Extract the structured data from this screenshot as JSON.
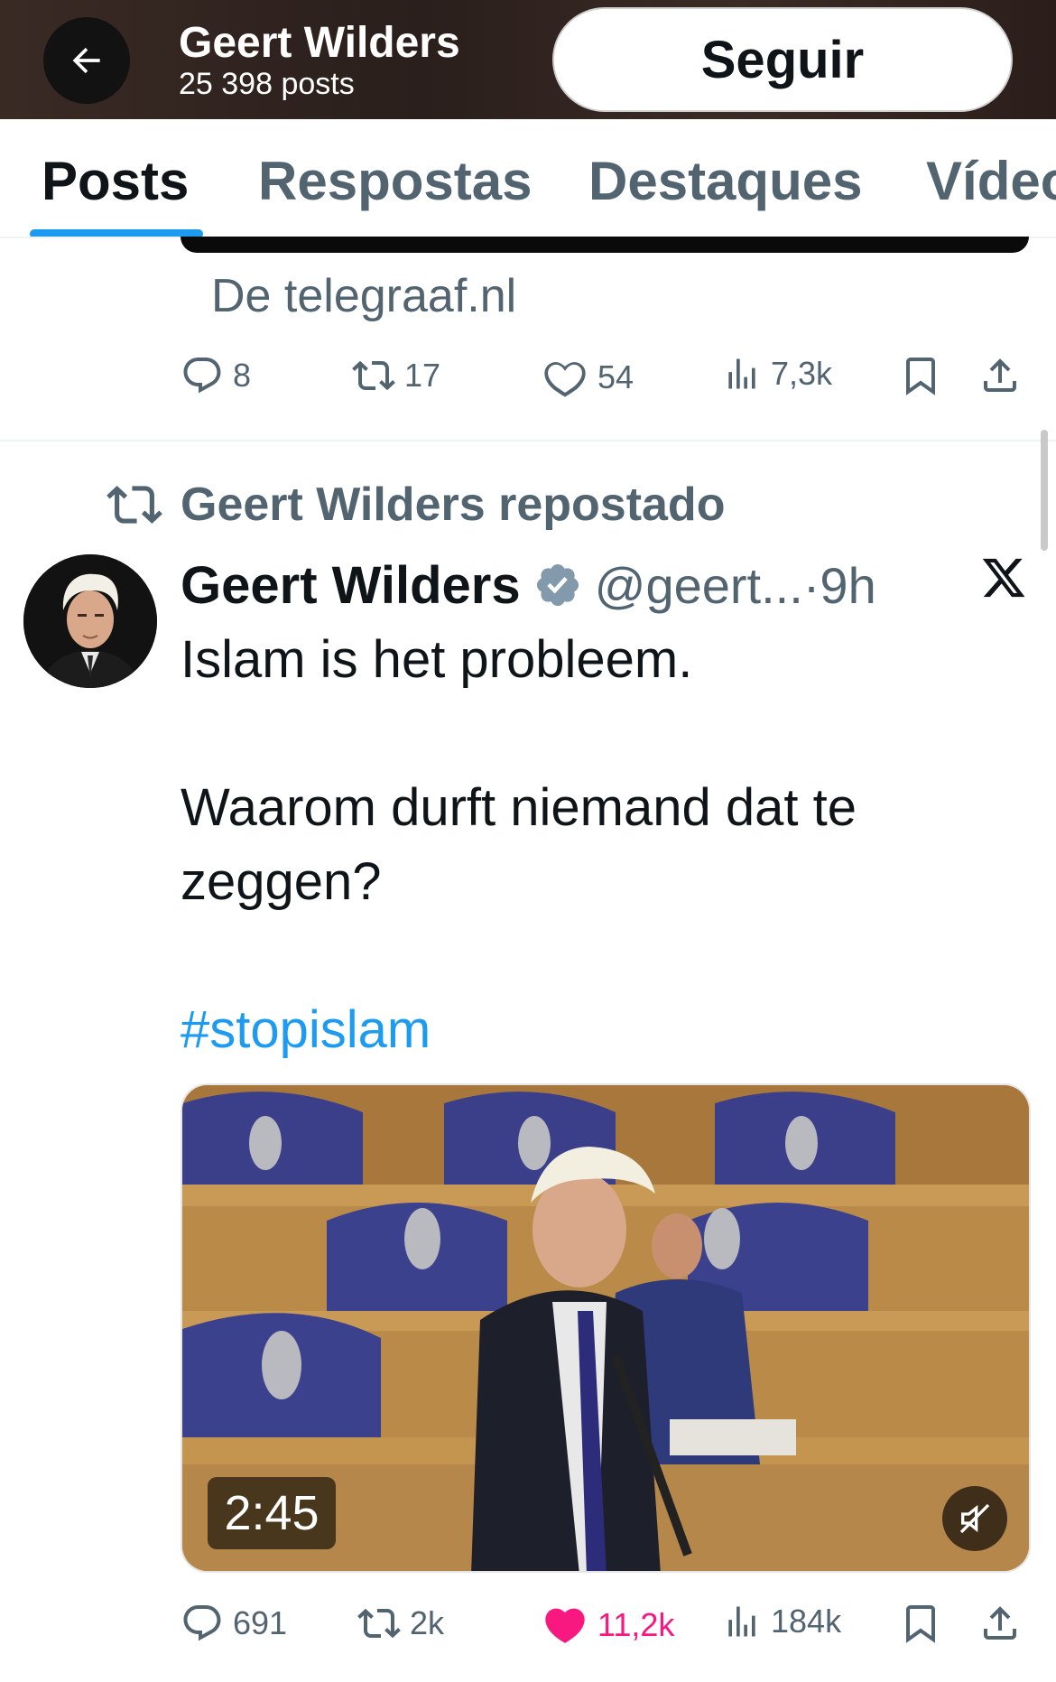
{
  "header": {
    "title": "Geert Wilders",
    "subtitle": "25 398 posts",
    "follow_label": "Seguir"
  },
  "tabs": [
    {
      "label": "Posts",
      "active": true
    },
    {
      "label": "Respostas",
      "active": false
    },
    {
      "label": "Destaques",
      "active": false
    },
    {
      "label": "Vídeos",
      "active": false
    }
  ],
  "previous_post": {
    "link_source": "De telegraaf.nl",
    "stats": {
      "replies": "8",
      "reposts": "17",
      "likes": "54",
      "views": "7,3k"
    }
  },
  "post": {
    "repost_label": "Geert Wilders repostado",
    "author_name": "Geert Wilders",
    "handle": "@geert...",
    "time": "·9h",
    "text_lines": [
      "Islam is het probleem.",
      "Waarom durft niemand dat te",
      "zeggen?"
    ],
    "hashtag": "#stopislam",
    "video_duration": "2:45",
    "stats": {
      "replies": "691",
      "reposts": "2k",
      "likes": "11,2k",
      "views": "184k"
    }
  },
  "colors": {
    "accent": "#1d9bf0",
    "like_active": "#f91880",
    "secondary_text": "#536471",
    "verified": "#829aab"
  },
  "icons": [
    "arrow-left-icon",
    "reply-icon",
    "repost-icon",
    "like-icon",
    "views-icon",
    "bookmark-icon",
    "share-icon",
    "verified-icon",
    "x-logo-icon",
    "mute-icon"
  ]
}
